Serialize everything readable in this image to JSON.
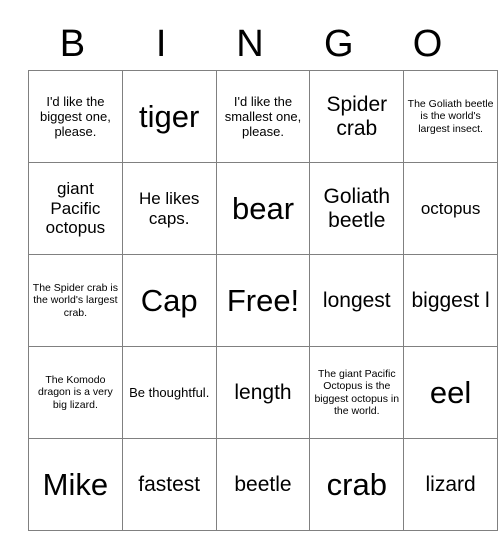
{
  "header": {
    "letters": [
      "B",
      "I",
      "N",
      "G",
      "O"
    ]
  },
  "grid": {
    "rows": [
      [
        {
          "text": "I'd like the biggest one, please.",
          "size": "s-sm"
        },
        {
          "text": "tiger",
          "size": "s-xxl"
        },
        {
          "text": "I'd like the smallest one, please.",
          "size": "s-sm"
        },
        {
          "text": "Spider crab",
          "size": "s-lg"
        },
        {
          "text": "The Goliath beetle is the world's largest insect.",
          "size": "s-xs"
        }
      ],
      [
        {
          "text": "giant Pacific octopus",
          "size": "s-md"
        },
        {
          "text": "He likes caps.",
          "size": "s-md"
        },
        {
          "text": "bear",
          "size": "s-xxl"
        },
        {
          "text": "Goliath beetle",
          "size": "s-lg"
        },
        {
          "text": "octopus",
          "size": "s-md"
        }
      ],
      [
        {
          "text": "The Spider crab is the world's largest crab.",
          "size": "s-xs"
        },
        {
          "text": "Cap",
          "size": "s-xxl"
        },
        {
          "text": "Free!",
          "size": "s-xxl"
        },
        {
          "text": "longest",
          "size": "s-lg"
        },
        {
          "text": "biggest l",
          "size": "s-lg"
        }
      ],
      [
        {
          "text": "The Komodo dragon is a very big lizard.",
          "size": "s-xs"
        },
        {
          "text": "Be thoughtful.",
          "size": "s-sm"
        },
        {
          "text": "length",
          "size": "s-lg"
        },
        {
          "text": "The giant Pacific Octopus is the biggest octopus in the world.",
          "size": "s-xs"
        },
        {
          "text": "eel",
          "size": "s-xxl"
        }
      ],
      [
        {
          "text": "Mike",
          "size": "s-xxl"
        },
        {
          "text": "fastest",
          "size": "s-lg"
        },
        {
          "text": "beetle",
          "size": "s-lg"
        },
        {
          "text": "crab",
          "size": "s-xxl"
        },
        {
          "text": "lizard",
          "size": "s-lg"
        }
      ]
    ]
  },
  "colors": {
    "background": "#ffffff",
    "text": "#000000",
    "cell_border": "#808080"
  }
}
